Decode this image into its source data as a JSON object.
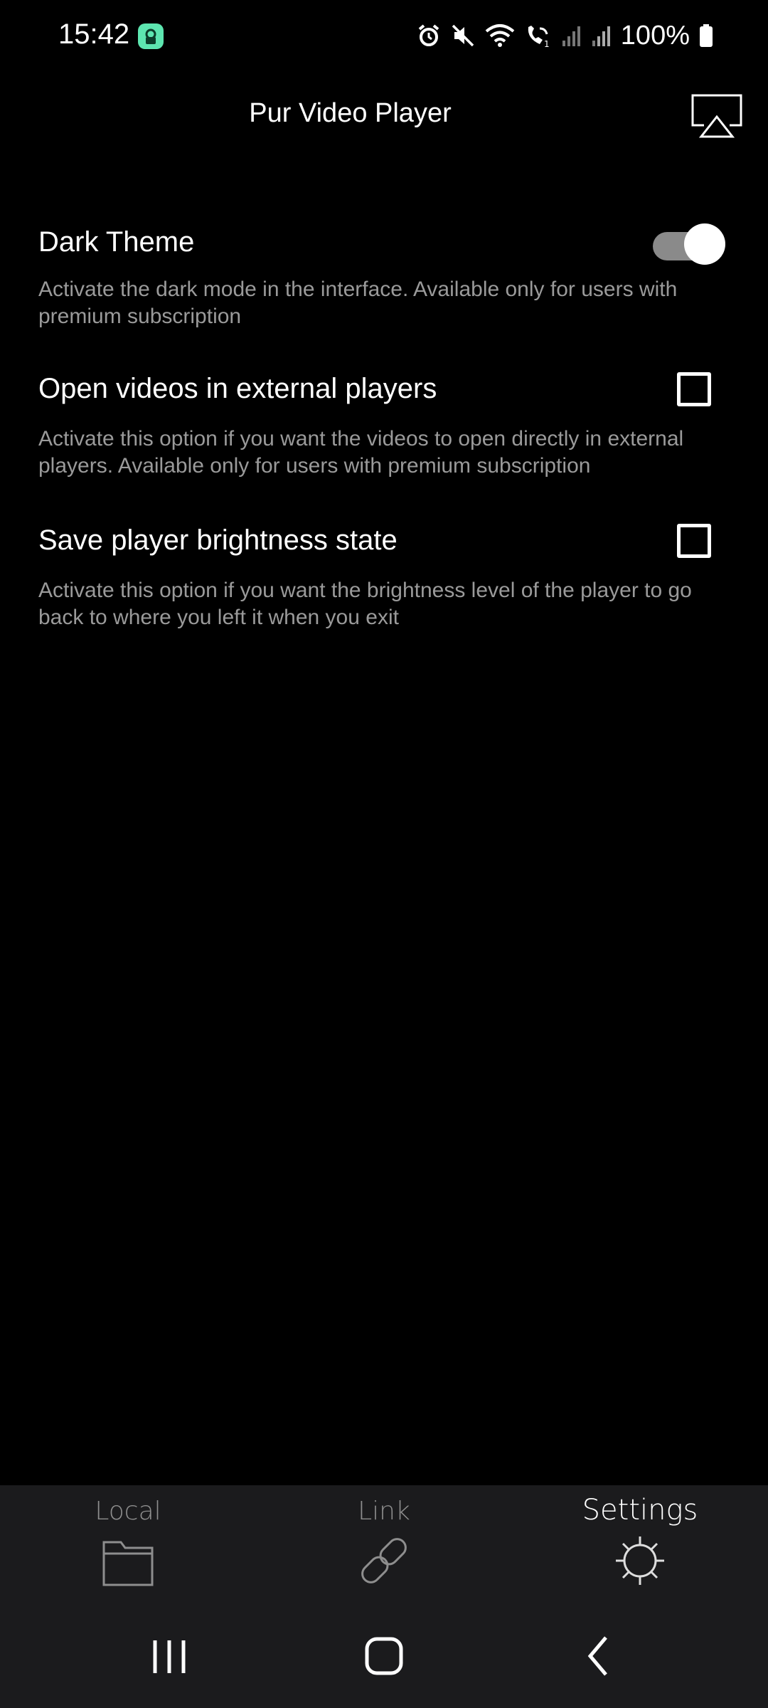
{
  "status_bar": {
    "time": "15:42",
    "battery": "100%",
    "icons": [
      "app-notification-icon",
      "alarm-icon",
      "mute-icon",
      "wifi-icon",
      "wifi-calling-icon",
      "signal-icon",
      "signal-icon",
      "battery-icon"
    ]
  },
  "header": {
    "title": "Pur Video Player",
    "cast_icon": "airplay-icon"
  },
  "settings": [
    {
      "title": "Dark Theme",
      "description": "Activate the dark mode in the interface. Available only for users with premium subscription",
      "control": "toggle",
      "checked": true
    },
    {
      "title": "Open videos in external players",
      "description": "Activate this option if you want the videos to open directly in external players. Available only for users with premium subscription",
      "control": "checkbox",
      "checked": false
    },
    {
      "title": "Save player brightness state",
      "description": "Activate this option if you want the brightness level of the player to go back to where you left it when you exit",
      "control": "checkbox",
      "checked": false
    }
  ],
  "tabs": [
    {
      "label": "Local",
      "icon": "folder-icon",
      "active": false
    },
    {
      "label": "Link",
      "icon": "link-icon",
      "active": false
    },
    {
      "label": "Settings",
      "icon": "gear-icon",
      "active": true
    }
  ],
  "nav": {
    "recents_icon": "recents-icon",
    "home_icon": "home-icon",
    "back_icon": "back-icon"
  },
  "colors": {
    "background": "#000000",
    "bar_background": "#1b1b1d",
    "secondary_text": "#9a9a9a",
    "toggle_track": "#8a8a8a",
    "app_icon": "#5de6b0"
  }
}
